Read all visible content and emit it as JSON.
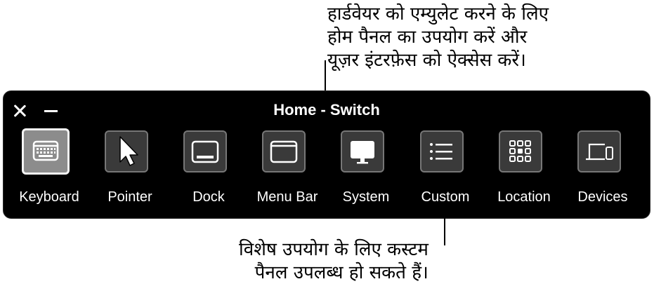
{
  "annotations": {
    "top": [
      "हार्डवेयर को एम्युलेट करने के लिए",
      "होम पैनल का उपयोग करें और",
      "यूज़र इंटरफ़ेस को ऐक्सेस करें।"
    ],
    "bottom": [
      "विशेष उपयोग के लिए कस्टम",
      "पैनल उपलब्ध हो सकते हैं।"
    ]
  },
  "panel": {
    "title": "Home - Switch",
    "selected": "Keyboard",
    "buttons": [
      {
        "label": "Keyboard",
        "icon": "keyboard-icon"
      },
      {
        "label": "Pointer",
        "icon": "pointer-arrow-icon"
      },
      {
        "label": "Dock",
        "icon": "dock-icon"
      },
      {
        "label": "Menu Bar",
        "icon": "menu-bar-icon"
      },
      {
        "label": "System",
        "icon": "monitor-icon"
      },
      {
        "label": "Custom",
        "icon": "list-icon"
      },
      {
        "label": "Location",
        "icon": "grid-icon"
      },
      {
        "label": "Devices",
        "icon": "devices-icon"
      }
    ]
  },
  "colors": {
    "panel_background": "#000000",
    "tile_background": "#3a3a3a",
    "selected_tile_background": "#8c8c8c",
    "text": "#ffffff"
  }
}
